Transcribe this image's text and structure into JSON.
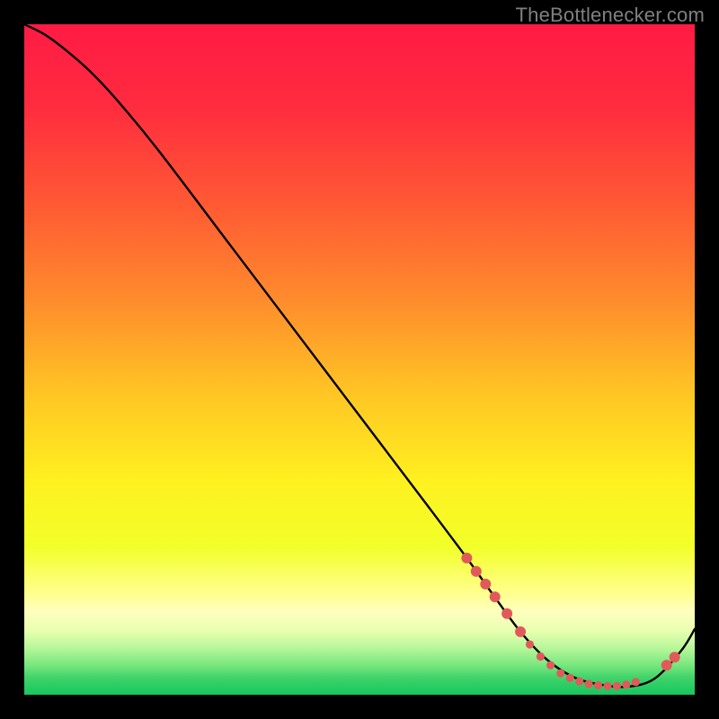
{
  "watermark": "TheBottlenecker.com",
  "chart_data": {
    "type": "line",
    "title": "",
    "xlabel": "",
    "ylabel": "",
    "xlim": [
      0,
      100
    ],
    "ylim": [
      0,
      100
    ],
    "gradient_stops": [
      {
        "offset": 0.0,
        "color": "#ff1b44"
      },
      {
        "offset": 0.12,
        "color": "#ff2b3f"
      },
      {
        "offset": 0.28,
        "color": "#ff5d33"
      },
      {
        "offset": 0.42,
        "color": "#ff8f2c"
      },
      {
        "offset": 0.55,
        "color": "#ffc524"
      },
      {
        "offset": 0.68,
        "color": "#fff020"
      },
      {
        "offset": 0.78,
        "color": "#f2ff2a"
      },
      {
        "offset": 0.845,
        "color": "#ffff88"
      },
      {
        "offset": 0.875,
        "color": "#ffffbe"
      },
      {
        "offset": 0.905,
        "color": "#e8ffb0"
      },
      {
        "offset": 0.93,
        "color": "#b7f79a"
      },
      {
        "offset": 0.955,
        "color": "#7be77f"
      },
      {
        "offset": 0.975,
        "color": "#3ed36a"
      },
      {
        "offset": 1.0,
        "color": "#17c65e"
      }
    ],
    "series": [
      {
        "name": "bottleneck-curve",
        "x": [
          0,
          3,
          6,
          10,
          14,
          20,
          30,
          40,
          50,
          60,
          66,
          70,
          74,
          78,
          82,
          86,
          90,
          94,
          98,
          100
        ],
        "y": [
          100,
          98.5,
          96.3,
          92.8,
          88.5,
          81.2,
          68.0,
          54.8,
          41.6,
          28.4,
          20.4,
          14.8,
          9.4,
          5.2,
          2.6,
          1.5,
          1.2,
          2.4,
          6.6,
          9.8
        ]
      }
    ],
    "markers": {
      "name": "highlight-dots",
      "color": "#e15a5a",
      "radius_lg": 6.0,
      "radius_sm": 4.6,
      "points": [
        {
          "x": 66.0,
          "y": 20.4,
          "r": "lg"
        },
        {
          "x": 67.4,
          "y": 18.4,
          "r": "lg"
        },
        {
          "x": 68.8,
          "y": 16.5,
          "r": "lg"
        },
        {
          "x": 70.2,
          "y": 14.6,
          "r": "lg"
        },
        {
          "x": 72.0,
          "y": 12.1,
          "r": "lg"
        },
        {
          "x": 74.0,
          "y": 9.4,
          "r": "lg"
        },
        {
          "x": 75.4,
          "y": 7.5,
          "r": "sm"
        },
        {
          "x": 77.0,
          "y": 5.7,
          "r": "sm"
        },
        {
          "x": 78.5,
          "y": 4.4,
          "r": "sm"
        },
        {
          "x": 80.0,
          "y": 3.2,
          "r": "sm"
        },
        {
          "x": 81.4,
          "y": 2.5,
          "r": "sm"
        },
        {
          "x": 82.8,
          "y": 2.0,
          "r": "sm"
        },
        {
          "x": 84.2,
          "y": 1.6,
          "r": "sm"
        },
        {
          "x": 85.6,
          "y": 1.4,
          "r": "sm"
        },
        {
          "x": 87.0,
          "y": 1.3,
          "r": "sm"
        },
        {
          "x": 88.4,
          "y": 1.3,
          "r": "sm"
        },
        {
          "x": 89.8,
          "y": 1.5,
          "r": "sm"
        },
        {
          "x": 91.2,
          "y": 1.9,
          "r": "sm"
        },
        {
          "x": 95.8,
          "y": 4.4,
          "r": "lg"
        },
        {
          "x": 97.0,
          "y": 5.6,
          "r": "lg"
        }
      ]
    }
  }
}
